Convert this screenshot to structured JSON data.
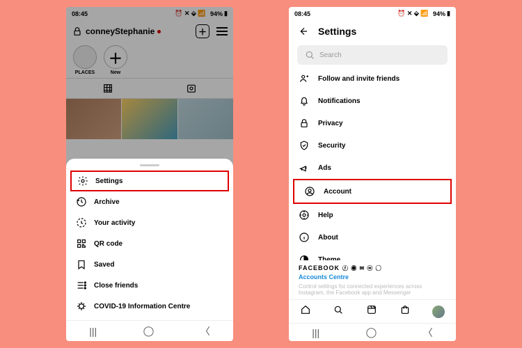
{
  "status": {
    "time": "08:45",
    "indicators": "⏰ ✕ ⬙ 📶",
    "battery": "94%"
  },
  "left": {
    "username": "conneyStephanie",
    "stories": [
      {
        "label": "PLACES"
      },
      {
        "label": "New"
      }
    ],
    "menu": [
      {
        "key": "settings",
        "label": "Settings",
        "hl": true
      },
      {
        "key": "archive",
        "label": "Archive"
      },
      {
        "key": "activity",
        "label": "Your activity"
      },
      {
        "key": "qr",
        "label": "QR code"
      },
      {
        "key": "saved",
        "label": "Saved"
      },
      {
        "key": "close",
        "label": "Close friends"
      },
      {
        "key": "covid",
        "label": "COVID-19 Information Centre"
      }
    ]
  },
  "right": {
    "title": "Settings",
    "search_placeholder": "Search",
    "items": [
      {
        "key": "follow",
        "label": "Follow and invite friends"
      },
      {
        "key": "notifications",
        "label": "Notifications"
      },
      {
        "key": "privacy",
        "label": "Privacy"
      },
      {
        "key": "security",
        "label": "Security"
      },
      {
        "key": "ads",
        "label": "Ads"
      },
      {
        "key": "account",
        "label": "Account",
        "hl": true
      },
      {
        "key": "help",
        "label": "Help"
      },
      {
        "key": "about",
        "label": "About"
      },
      {
        "key": "theme",
        "label": "Theme"
      }
    ],
    "brand": "FACEBOOK",
    "accounts_centre": "Accounts Centre",
    "subtext": "Control settings for connected experiences across Instagram, the Facebook app and Messenger"
  }
}
